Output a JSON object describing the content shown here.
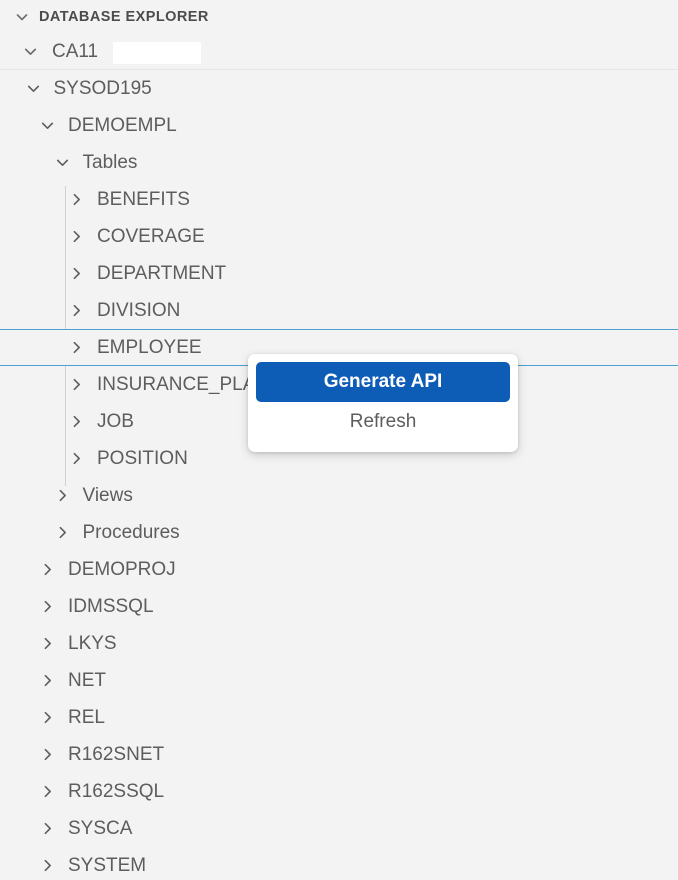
{
  "panel": {
    "header": {
      "title": "DATABASE EXPLORER",
      "collapse_icon": "chevron-down-icon"
    },
    "root": {
      "label": "CA11",
      "expanded": true,
      "redacted_field": ""
    }
  },
  "tree": {
    "items": [
      {
        "label": "SYSOD195",
        "depth": 1,
        "expanded": true,
        "state": "normal"
      },
      {
        "label": "DEMOEMPL",
        "depth": 2,
        "expanded": true,
        "state": "normal"
      },
      {
        "label": "Tables",
        "depth": 3,
        "expanded": true,
        "state": "normal"
      },
      {
        "label": "BENEFITS",
        "depth": 4,
        "expanded": false,
        "state": "normal"
      },
      {
        "label": "COVERAGE",
        "depth": 4,
        "expanded": false,
        "state": "normal"
      },
      {
        "label": "DEPARTMENT",
        "depth": 4,
        "expanded": false,
        "state": "normal"
      },
      {
        "label": "DIVISION",
        "depth": 4,
        "expanded": false,
        "state": "normal"
      },
      {
        "label": "EMPLOYEE",
        "depth": 4,
        "expanded": false,
        "state": "selected"
      },
      {
        "label": "INSURANCE_PLAN",
        "depth": 4,
        "expanded": false,
        "state": "normal"
      },
      {
        "label": "JOB",
        "depth": 4,
        "expanded": false,
        "state": "normal"
      },
      {
        "label": "POSITION",
        "depth": 4,
        "expanded": false,
        "state": "normal"
      },
      {
        "label": "Views",
        "depth": 3,
        "expanded": false,
        "state": "normal"
      },
      {
        "label": "Procedures",
        "depth": 3,
        "expanded": false,
        "state": "normal"
      },
      {
        "label": "DEMOPROJ",
        "depth": 2,
        "expanded": false,
        "state": "normal"
      },
      {
        "label": "IDMSSQL",
        "depth": 2,
        "expanded": false,
        "state": "normal"
      },
      {
        "label": "LKYS",
        "depth": 2,
        "expanded": false,
        "state": "normal"
      },
      {
        "label": "NET",
        "depth": 2,
        "expanded": false,
        "state": "normal"
      },
      {
        "label": "REL",
        "depth": 2,
        "expanded": false,
        "state": "normal"
      },
      {
        "label": "R162SNET",
        "depth": 2,
        "expanded": false,
        "state": "normal"
      },
      {
        "label": "R162SSQL",
        "depth": 2,
        "expanded": false,
        "state": "normal"
      },
      {
        "label": "SYSCA",
        "depth": 2,
        "expanded": false,
        "state": "normal"
      },
      {
        "label": "SYSTEM",
        "depth": 2,
        "expanded": false,
        "state": "normal"
      }
    ]
  },
  "context_menu": {
    "target": "EMPLOYEE",
    "items": [
      {
        "label": "Generate API",
        "highlighted": true
      },
      {
        "label": "Refresh",
        "highlighted": false
      }
    ]
  },
  "colors": {
    "panel_background": "#f3f3f3",
    "text": "#5d5d5d",
    "header_text": "#4c4c4c",
    "selection_border": "#4a9fd4",
    "menu_highlight": "#0d5cb6",
    "menu_background": "#ffffff",
    "guide_line": "#cfcfcf"
  }
}
